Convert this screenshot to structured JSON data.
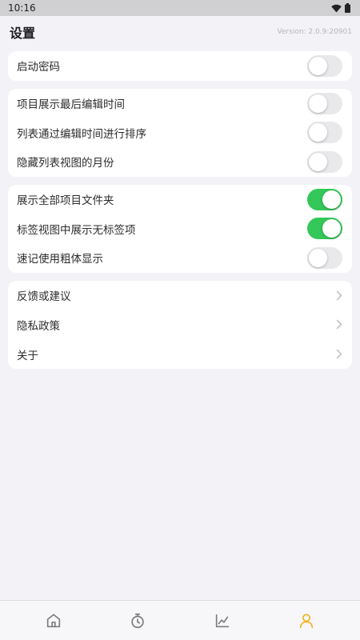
{
  "status_bar": {
    "time": "10:16"
  },
  "header": {
    "title": "设置",
    "version": "Version: 2.0.9:20901"
  },
  "sections": [
    {
      "rows": [
        {
          "label": "启动密码",
          "control": "toggle",
          "on": false
        }
      ]
    },
    {
      "rows": [
        {
          "label": "项目展示最后编辑时间",
          "control": "toggle",
          "on": false
        },
        {
          "label": "列表通过编辑时间进行排序",
          "control": "toggle",
          "on": false
        },
        {
          "label": "隐藏列表视图的月份",
          "control": "toggle",
          "on": false
        }
      ]
    },
    {
      "rows": [
        {
          "label": "展示全部项目文件夹",
          "control": "toggle",
          "on": true
        },
        {
          "label": "标签视图中展示无标签项",
          "control": "toggle",
          "on": true
        },
        {
          "label": "速记使用粗体显示",
          "control": "toggle",
          "on": false
        }
      ]
    },
    {
      "rows": [
        {
          "label": "反馈或建议",
          "control": "chevron"
        },
        {
          "label": "隐私政策",
          "control": "chevron"
        },
        {
          "label": "关于",
          "control": "chevron"
        }
      ]
    }
  ],
  "tabbar": {
    "items": [
      {
        "icon": "home-icon",
        "active": false
      },
      {
        "icon": "timer-icon",
        "active": false
      },
      {
        "icon": "chart-icon",
        "active": false
      },
      {
        "icon": "user-icon",
        "active": true
      }
    ],
    "active_color": "#f0b429",
    "inactive_color": "#7c7c80"
  },
  "colors": {
    "toggle_on": "#34c759",
    "toggle_off": "#e9e9eb",
    "background": "#f2f2f7"
  }
}
